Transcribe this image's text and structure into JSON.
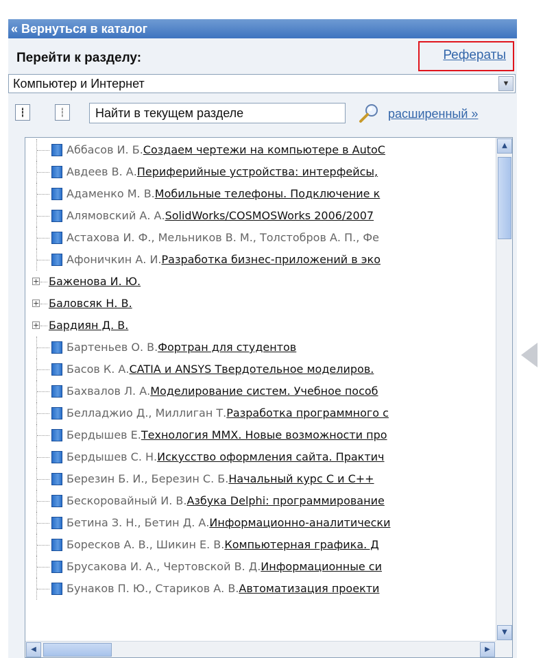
{
  "back_link": "« Вернуться в каталог",
  "section_label": "Перейти к разделу:",
  "referaty_link": "Рефераты",
  "section_select": {
    "selected": "Компьютер и Интернет"
  },
  "search": {
    "value": "Найти в текущем разделе",
    "advanced_label": "расширенный »"
  },
  "icons": {
    "tree_expand": "tree-expand-icon",
    "tree_collapse": "tree-collapse-icon",
    "search": "magnifier-icon",
    "book": "book-icon",
    "collapse_panel": "triangle-left-icon"
  },
  "colors": {
    "header_bar": "#4a7cc3",
    "link": "#3366aa",
    "highlight": "#e0141c"
  },
  "tree_items": [
    {
      "type": "leaf",
      "author": "Аббасов И. Б.",
      "title": "Создаем чертежи на компьютере в AutoC"
    },
    {
      "type": "leaf",
      "author": "Авдеев В. А.",
      "title": "Периферийные устройства: интерфейсы,"
    },
    {
      "type": "leaf",
      "author": "Адаменко М. В.",
      "title": "Мобильные телефоны. Подключение к"
    },
    {
      "type": "leaf",
      "author": "Алямовский А. А.",
      "title": "SolidWorks/COSMOSWorks 2006/2007"
    },
    {
      "type": "leaf",
      "author": "Астахова И. Ф., Мельников В. М., Толстобров А. П., Фе",
      "title": ""
    },
    {
      "type": "leaf",
      "author": "Афоничкин А. И.",
      "title": "Разработка бизнес-приложений в эко"
    },
    {
      "type": "node",
      "author": "",
      "title": "Баженова И. Ю."
    },
    {
      "type": "node",
      "author": "",
      "title": "Баловсяк Н. В."
    },
    {
      "type": "node",
      "author": "",
      "title": "Бардиян Д. В."
    },
    {
      "type": "leaf",
      "author": "Бартеньев О. В.",
      "title": "Фортран для студентов"
    },
    {
      "type": "leaf",
      "author": "Басов К. А.",
      "title": "CATIA и ANSYS Твердотельное моделиров."
    },
    {
      "type": "leaf",
      "author": "Бахвалов Л. А.",
      "title": "Моделирование систем. Учебное пособ"
    },
    {
      "type": "leaf",
      "author": "Белладжио Д., Миллиган Т.",
      "title": "Разработка программного с"
    },
    {
      "type": "leaf",
      "author": "Бердышев Е.",
      "title": "Технология MMX. Новые возможности про"
    },
    {
      "type": "leaf",
      "author": "Бердышев С. Н.",
      "title": "Искусство оформления сайта. Практич"
    },
    {
      "type": "leaf",
      "author": "Березин Б. И., Березин С. Б.",
      "title": "Начальный курс С и С++"
    },
    {
      "type": "leaf",
      "author": "Бескоровайный И. В.",
      "title": "Азбука Delphi: программирование"
    },
    {
      "type": "leaf",
      "author": "Бетина З. Н., Бетин Д. А.",
      "title": "Информационно-аналитически"
    },
    {
      "type": "leaf",
      "author": "Боресков А. В., Шикин Е. В.",
      "title": "Компьютерная графика. Д"
    },
    {
      "type": "leaf",
      "author": "Брусакова И. А., Чертовской В. Д.",
      "title": "Информационные си"
    },
    {
      "type": "leaf",
      "author": "Бунаков П. Ю., Стариков А. В.",
      "title": "Автоматизация проекти"
    }
  ]
}
